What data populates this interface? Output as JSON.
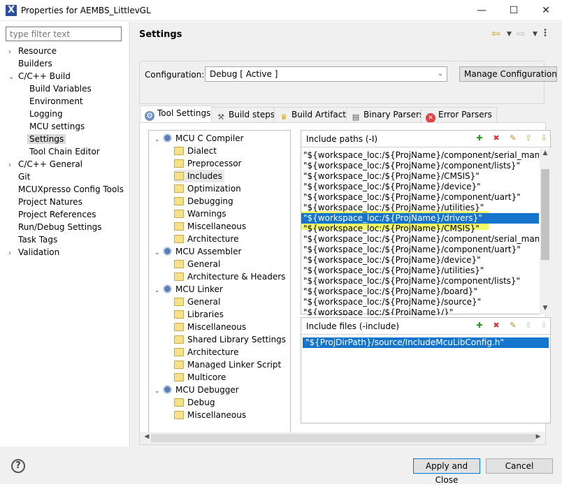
{
  "window": {
    "title": "Properties for AEMBS_LittlevGL",
    "minimize_glyph": "—",
    "maximize_glyph": "☐",
    "close_glyph": "✕"
  },
  "filter": {
    "placeholder": "type filter text"
  },
  "nav": {
    "items": [
      {
        "label": "Resource",
        "expander": "›"
      },
      {
        "label": "Builders",
        "expander": ""
      },
      {
        "label": "C/C++ Build",
        "expander": "⌄"
      },
      {
        "label": "Build Variables",
        "expander": ""
      },
      {
        "label": "Environment",
        "expander": ""
      },
      {
        "label": "Logging",
        "expander": ""
      },
      {
        "label": "MCU settings",
        "expander": ""
      },
      {
        "label": "Settings",
        "expander": ""
      },
      {
        "label": "Tool Chain Editor",
        "expander": ""
      },
      {
        "label": "C/C++ General",
        "expander": "›"
      },
      {
        "label": "Git",
        "expander": ""
      },
      {
        "label": "MCUXpresso Config Tools",
        "expander": ""
      },
      {
        "label": "Project Natures",
        "expander": ""
      },
      {
        "label": "Project References",
        "expander": ""
      },
      {
        "label": "Run/Debug Settings",
        "expander": ""
      },
      {
        "label": "Task Tags",
        "expander": ""
      },
      {
        "label": "Validation",
        "expander": "›"
      }
    ]
  },
  "header": {
    "title": "Settings"
  },
  "configuration": {
    "label": "Configuration:",
    "value": "Debug  [ Active ]",
    "manage_label": "Manage Configurations..."
  },
  "tabs": [
    {
      "label": "Tool Settings"
    },
    {
      "label": "Build steps"
    },
    {
      "label": "Build Artifact"
    },
    {
      "label": "Binary Parsers"
    },
    {
      "label": "Error Parsers"
    }
  ],
  "tool_tree": {
    "items": [
      "MCU C Compiler",
      "Dialect",
      "Preprocessor",
      "Includes",
      "Optimization",
      "Debugging",
      "Warnings",
      "Miscellaneous",
      "Architecture",
      "MCU Assembler",
      "General",
      "Architecture & Headers",
      "MCU Linker",
      "General",
      "Libraries",
      "Miscellaneous",
      "Shared Library Settings",
      "Architecture",
      "Managed Linker Script",
      "Multicore",
      "MCU Debugger",
      "Debug",
      "Miscellaneous"
    ]
  },
  "include_paths": {
    "title": "Include paths (-I)",
    "items": [
      "\"${workspace_loc:/${ProjName}/component/serial_manager}\"",
      "\"${workspace_loc:/${ProjName}/component/lists}\"",
      "\"${workspace_loc:/${ProjName}/CMSIS}\"",
      "\"${workspace_loc:/${ProjName}/device}\"",
      "\"${workspace_loc:/${ProjName}/component/uart}\"",
      "\"${workspace_loc:/${ProjName}/utilities}\"",
      "\"${workspace_loc:/${ProjName}/drivers}\"",
      "\"${workspace_loc:/${ProjName}/CMSIS}\"",
      "\"${workspace_loc:/${ProjName}/component/serial_manager}\"",
      "\"${workspace_loc:/${ProjName}/component/uart}\"",
      "\"${workspace_loc:/${ProjName}/device}\"",
      "\"${workspace_loc:/${ProjName}/utilities}\"",
      "\"${workspace_loc:/${ProjName}/component/lists}\"",
      "\"${workspace_loc:/${ProjName}/board}\"",
      "\"${workspace_loc:/${ProjName}/source}\"",
      "\"${workspace_loc:/${ProjName}/}\""
    ]
  },
  "include_files": {
    "title": "Include files (-include)",
    "items": [
      "\"${ProjDirPath}/source/IncludeMcuLibConfig.h\""
    ]
  },
  "footer": {
    "help": "?",
    "apply_label": "Apply and Close",
    "cancel_label": "Cancel"
  },
  "colors": {
    "selection": "#1575cc",
    "highlight": "#f1f94b"
  }
}
